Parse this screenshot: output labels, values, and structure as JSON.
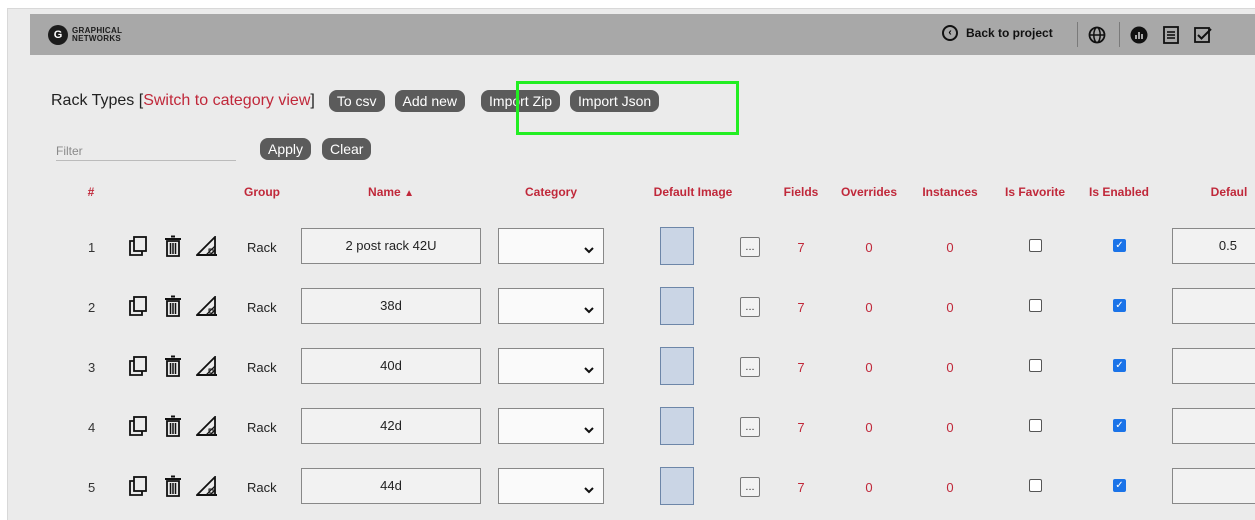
{
  "header": {
    "logo_mark": "G",
    "logo_line1": "GRAPHICAL",
    "logo_line2": "NETWORKS",
    "back_label": "Back to project",
    "icons": [
      "chevron-left-icon",
      "globe-icon",
      "reports-icon",
      "list-icon",
      "check-square-icon"
    ]
  },
  "toolbar": {
    "title": "Rack Types",
    "bracket_open": "[",
    "switch_link": "Switch to category view",
    "bracket_close": "]",
    "to_csv": "To csv",
    "add_new": "Add new",
    "import_zip": "Import Zip",
    "import_json": "Import Json"
  },
  "filter": {
    "placeholder": "Filter",
    "value": "",
    "apply": "Apply",
    "clear": "Clear"
  },
  "table": {
    "columns": {
      "index": "#",
      "group": "Group",
      "name": "Name",
      "sort": "▲",
      "category": "Category",
      "default_image": "Default Image",
      "fields": "Fields",
      "overrides": "Overrides",
      "instances": "Instances",
      "is_favorite": "Is Favorite",
      "is_enabled": "Is Enabled",
      "default": "Defaul"
    },
    "rows": [
      {
        "index": "1",
        "group": "Rack",
        "name": "2 post rack 42U",
        "category": "",
        "fields": "7",
        "overrides": "0",
        "instances": "0",
        "is_favorite": false,
        "is_enabled": true,
        "default": "0.5"
      },
      {
        "index": "2",
        "group": "Rack",
        "name": "38d",
        "category": "",
        "fields": "7",
        "overrides": "0",
        "instances": "0",
        "is_favorite": false,
        "is_enabled": true,
        "default": ""
      },
      {
        "index": "3",
        "group": "Rack",
        "name": "40d",
        "category": "",
        "fields": "7",
        "overrides": "0",
        "instances": "0",
        "is_favorite": false,
        "is_enabled": true,
        "default": ""
      },
      {
        "index": "4",
        "group": "Rack",
        "name": "42d",
        "category": "",
        "fields": "7",
        "overrides": "0",
        "instances": "0",
        "is_favorite": false,
        "is_enabled": true,
        "default": ""
      },
      {
        "index": "5",
        "group": "Rack",
        "name": "44d",
        "category": "",
        "fields": "7",
        "overrides": "0",
        "instances": "0",
        "is_favorite": false,
        "is_enabled": true,
        "default": ""
      }
    ],
    "dots_label": "...",
    "check_glyph": "✓"
  },
  "colors": {
    "accent_red": "#c0283a",
    "topbar": "#a8a8a8",
    "pill": "#5b5b5b",
    "highlight": "#22ee22",
    "checkbox_on": "#1a73e8",
    "image_fill": "#cad5e5"
  }
}
